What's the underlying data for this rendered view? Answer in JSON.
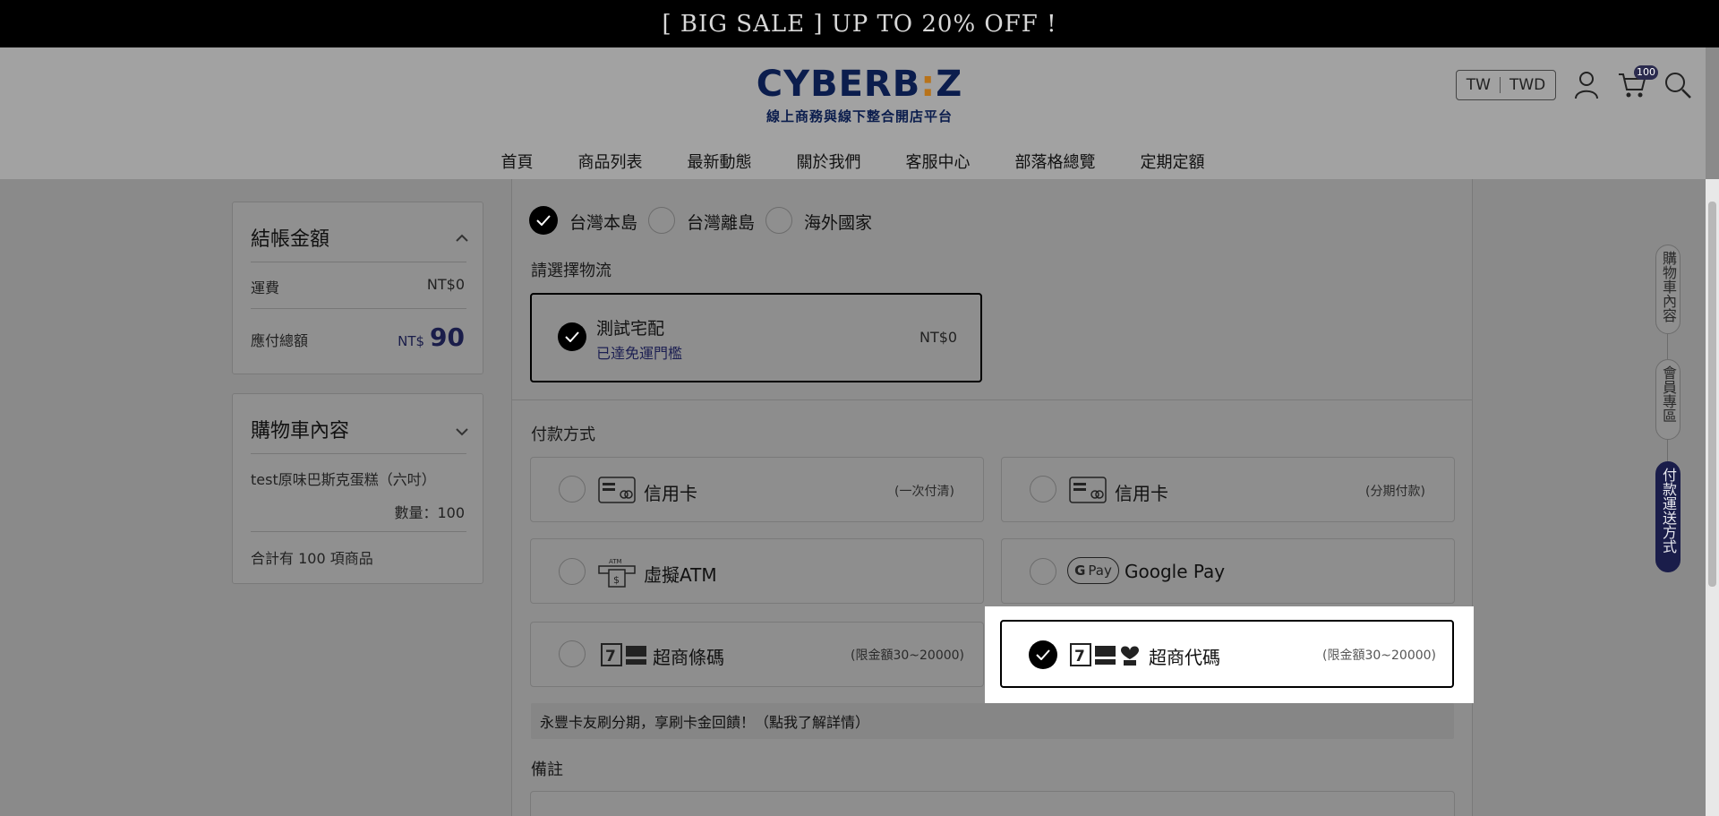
{
  "banner": {
    "text": "[ BIG SALE ] UP TO 20% OFF !"
  },
  "header": {
    "logo_main_left": "CYBERB",
    "logo_main_mid": ":",
    "logo_main_right": "Z",
    "logo_sub": "線上商務與線下整合開店平台",
    "lang": "TW",
    "currency": "TWD",
    "cart_count": "100",
    "icons": [
      "user-icon",
      "cart-icon",
      "search-icon"
    ]
  },
  "nav": {
    "items": [
      "首頁",
      "商品列表",
      "最新動態",
      "關於我們",
      "客服中心",
      "部落格總覽",
      "定期定額"
    ]
  },
  "checkout_summary": {
    "title": "結帳金額",
    "shipping_label": "運費",
    "shipping_value": "NT$0",
    "total_label": "應付總額",
    "total_currency": "NT$",
    "total_value": "90"
  },
  "cart_summary": {
    "title": "購物車內容",
    "item_name": "test原味巴斯克蛋糕（六吋）",
    "item_qty": "數量：100",
    "total_count": "合計有 100 項商品"
  },
  "region": {
    "options": [
      "台灣本島",
      "台灣離島",
      "海外國家"
    ],
    "selected": "台灣本島"
  },
  "logistics": {
    "label": "請選擇物流",
    "option_name": "測試宅配",
    "option_desc": "已達免運門檻",
    "option_price": "NT$0"
  },
  "payment": {
    "label": "付款方式",
    "credit_once": {
      "name": "信用卡",
      "note": "(一次付清)"
    },
    "credit_installment": {
      "name": "信用卡",
      "note": "(分期付款)"
    },
    "atm": {
      "name": "虛擬ATM"
    },
    "googlepay": {
      "name": "Google Pay",
      "badge": "Pay"
    },
    "cvs_barcode": {
      "name": "超商條碼",
      "note": "(限金額30~20000)"
    },
    "cvs_code": {
      "name": "超商代碼",
      "note": "(限金額30~20000)"
    },
    "selected": "超商代碼"
  },
  "promo": {
    "text": "永豐卡友刷分期，享刷卡金回饋！（點我了解詳情）"
  },
  "remark": {
    "label": "備註"
  },
  "side_tabs": [
    "購物車內容",
    "會員專區",
    "付款運送方式"
  ],
  "colors": {
    "brand_navy": "#1a1d4a",
    "logo_gold": "#b8731a",
    "banner_bg": "#000000"
  }
}
